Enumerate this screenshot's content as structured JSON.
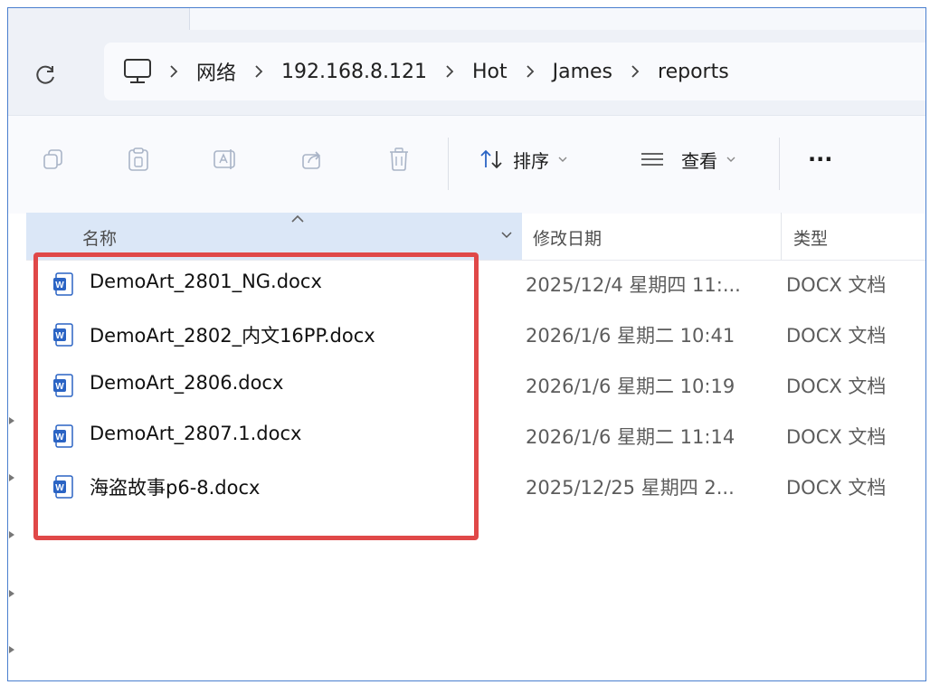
{
  "breadcrumb": {
    "items": [
      "网络",
      "192.168.8.121",
      "Hot",
      "James",
      "reports"
    ]
  },
  "toolbar": {
    "sort_label": "排序",
    "view_label": "查看",
    "more_label": "···"
  },
  "columns": {
    "name": "名称",
    "date": "修改日期",
    "type": "类型"
  },
  "files": [
    {
      "name": "DemoArt_2801_NG.docx",
      "date": "2025/12/4 星期四 11:...",
      "type": "DOCX 文档"
    },
    {
      "name": "DemoArt_2802_内文16PP.docx",
      "date": "2026/1/6 星期二 10:41",
      "type": "DOCX 文档"
    },
    {
      "name": "DemoArt_2806.docx",
      "date": "2026/1/6 星期二 10:19",
      "type": "DOCX 文档"
    },
    {
      "name": "DemoArt_2807.1.docx",
      "date": "2026/1/6 星期二 11:14",
      "type": "DOCX 文档"
    },
    {
      "name": "海盗故事p6-8.docx",
      "date": "2025/12/25 星期四 2...",
      "type": "DOCX 文档"
    }
  ],
  "colors": {
    "accent": "#4a7fcf",
    "highlight": "#e04848",
    "word_icon": "#2b64c4"
  }
}
